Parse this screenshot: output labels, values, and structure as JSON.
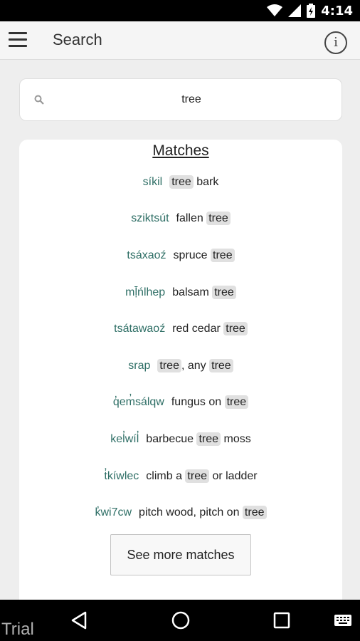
{
  "status_bar": {
    "time": "4:14"
  },
  "app_bar": {
    "title": "Search"
  },
  "search": {
    "query": "tree"
  },
  "matches": {
    "title": "Matches",
    "items": [
      {
        "word": "síkil",
        "definition": [
          {
            "t": "tree",
            "m": true
          },
          {
            "t": " bark",
            "m": false
          }
        ]
      },
      {
        "word": "sziktsút",
        "definition": [
          {
            "t": "fallen ",
            "m": false
          },
          {
            "t": "tree",
            "m": true
          }
        ]
      },
      {
        "word": "tsáxaoź",
        "definition": [
          {
            "t": "spruce ",
            "m": false
          },
          {
            "t": "tree",
            "m": true
          }
        ]
      },
      {
        "word": "mḹńlhep",
        "definition": [
          {
            "t": "balsam ",
            "m": false
          },
          {
            "t": "tree",
            "m": true
          }
        ]
      },
      {
        "word": "tsátawaoź",
        "definition": [
          {
            "t": "red cedar ",
            "m": false
          },
          {
            "t": "tree",
            "m": true
          }
        ]
      },
      {
        "word": "srap",
        "definition": [
          {
            "t": "tree",
            "m": true
          },
          {
            "t": ", any ",
            "m": false
          },
          {
            "t": "tree",
            "m": true
          }
        ]
      },
      {
        "word": "q̓em̓sálqw",
        "definition": [
          {
            "t": "fungus on ",
            "m": false
          },
          {
            "t": "tree",
            "m": true
          }
        ]
      },
      {
        "word": "kel̓wíl̓",
        "definition": [
          {
            "t": "barbecue ",
            "m": false
          },
          {
            "t": "tree",
            "m": true
          },
          {
            "t": " moss",
            "m": false
          }
        ]
      },
      {
        "word": "t̓kíwlec",
        "definition": [
          {
            "t": "climb a ",
            "m": false
          },
          {
            "t": "tree",
            "m": true
          },
          {
            "t": " or ladder",
            "m": false
          }
        ]
      },
      {
        "word": "k̓wi7cw",
        "definition": [
          {
            "t": "pitch wood, pitch on ",
            "m": false
          },
          {
            "t": "tree",
            "m": true
          }
        ]
      }
    ],
    "more_label": "See more matches"
  },
  "watermark": "Trial"
}
